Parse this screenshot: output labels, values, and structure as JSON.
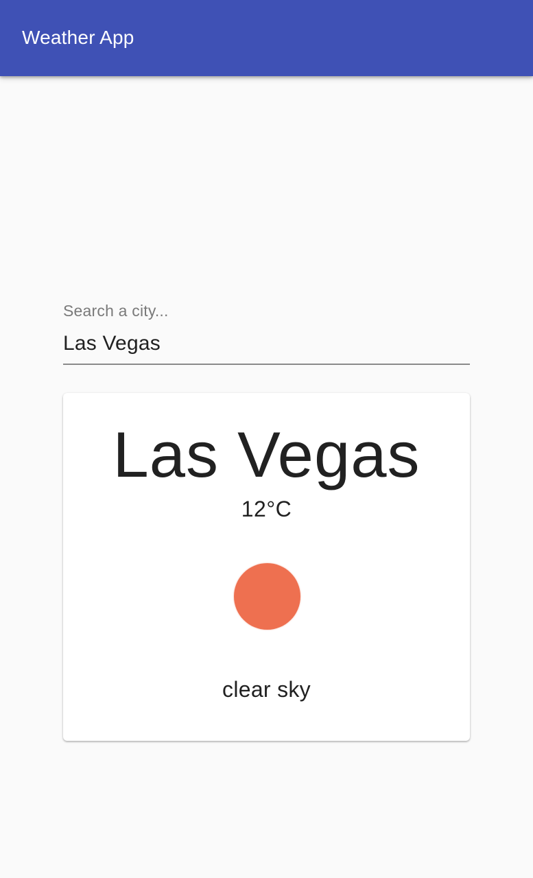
{
  "app_bar": {
    "title": "Weather App",
    "background_color": "#3f51b5"
  },
  "search": {
    "label": "Search a city...",
    "value": "Las Vegas"
  },
  "weather_card": {
    "city": "Las Vegas",
    "temperature": "12°C",
    "icon": "sun-icon",
    "icon_color": "#ee7050",
    "description": "clear sky"
  }
}
